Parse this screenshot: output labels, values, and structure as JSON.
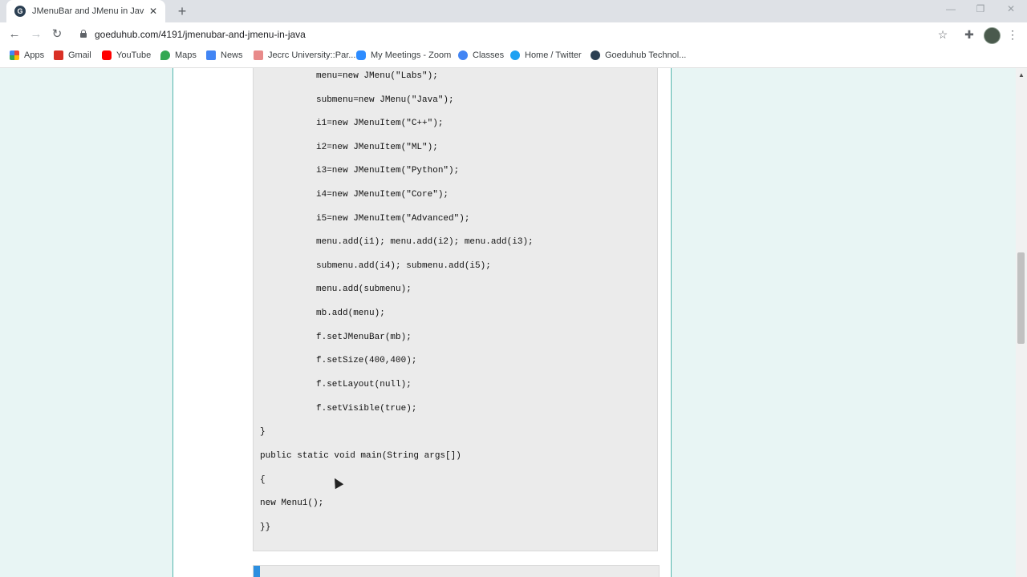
{
  "tab": {
    "title": "JMenuBar and JMenu in Java - Goe",
    "favicon_letter": "G"
  },
  "window_controls": {
    "minimize": "—",
    "maximize": "❐",
    "close": "✕"
  },
  "toolbar": {
    "url": "goeduhub.com/4191/jmenubar-and-jmenu-in-java"
  },
  "bookmarks": [
    {
      "label": "Apps",
      "color": "#e8453c"
    },
    {
      "label": "Gmail",
      "color": "#d93025"
    },
    {
      "label": "YouTube",
      "color": "#ff0000"
    },
    {
      "label": "Maps",
      "color": "#34a853"
    },
    {
      "label": "News",
      "color": "#4285f4"
    },
    {
      "label": "Jecrc University::Par...",
      "color": "#e88a8a"
    },
    {
      "label": "My Meetings - Zoom",
      "color": "#2d8cff"
    },
    {
      "label": "Classes",
      "color": "#4285f4"
    },
    {
      "label": "Home / Twitter",
      "color": "#1da1f2"
    },
    {
      "label": "Goeduhub Technol...",
      "color": "#2b3f52"
    }
  ],
  "code": {
    "lines": [
      "menu=new JMenu(\"Labs\");",
      "submenu=new JMenu(\"Java\");",
      "i1=new JMenuItem(\"C++\");",
      "i2=new JMenuItem(\"ML\");",
      "i3=new JMenuItem(\"Python\");",
      "i4=new JMenuItem(\"Core\");",
      "i5=new JMenuItem(\"Advanced\");",
      "menu.add(i1); menu.add(i2); menu.add(i3);",
      "submenu.add(i4); submenu.add(i5);",
      "menu.add(submenu);",
      "mb.add(menu);",
      "f.setJMenuBar(mb);",
      "f.setSize(400,400);",
      "f.setLayout(null);",
      "f.setVisible(true);",
      "}",
      "public static void main(String args[])",
      "{",
      "new Menu1();",
      "}}"
    ]
  }
}
